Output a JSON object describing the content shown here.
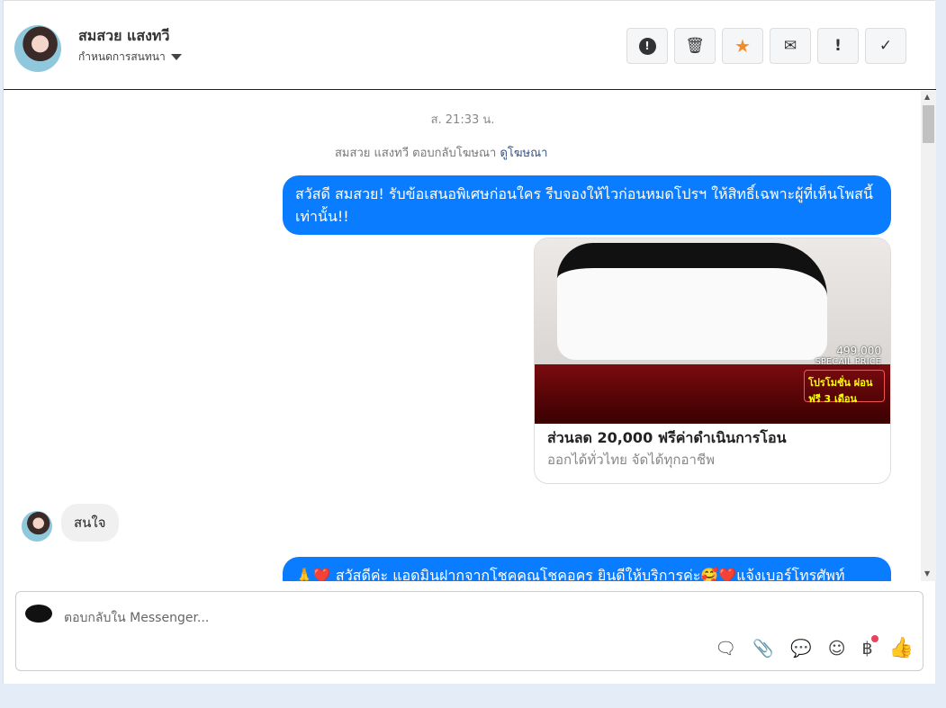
{
  "header": {
    "name": "สมสวย แสงทวี",
    "subtitle": "กำหนดการสนทนา",
    "buttons": [
      {
        "icon": "alert-icon",
        "glyph": "!"
      },
      {
        "icon": "trash-icon",
        "glyph": "🗑"
      },
      {
        "icon": "star-icon",
        "glyph": "★"
      },
      {
        "icon": "envelope-icon",
        "glyph": "✉"
      },
      {
        "icon": "exclamation-icon",
        "glyph": "!"
      },
      {
        "icon": "check-icon",
        "glyph": "✓"
      }
    ]
  },
  "chat": {
    "timestamp": "ส. 21:33 น.",
    "ad_note": "สมสวย แสงทวี ตอบกลับโฆษณา",
    "ad_link": "ดูโฆษณา",
    "msg1": "สวัสดี สมสวย! รับข้อเสนอพิเศษก่อนใคร รีบจองให้ไวก่อนหมดโปรฯ ให้สิทธิ์เฉพาะผู้ที่เห็นโพสนี้เท่านั้น!!",
    "card": {
      "price": "499,000",
      "price_label": "SPECAIL PRICE",
      "promo": "โปรโมชั่น ผ่อนฟรี 3 เดือน",
      "title": "ส่วนลด 20,000 ฟรีค่าดำเนินการโอน",
      "subtitle": "ออกได้ทั่วไทย จัดได้ทุกอาชีพ"
    },
    "incoming": "สนใจ",
    "msg2": "🙏❤️ สวัสดีค่ะ แอดมินฝากจากโชคคูณโชคอคร ยินดีให้บริการค่ะ🥰❤️แจ้งเบอร์โทรศัพท์"
  },
  "composer": {
    "placeholder": "ตอบกลับใน Messenger...",
    "tools": [
      "saved-reply-icon",
      "attachment-icon",
      "comment-icon",
      "emoji-icon",
      "baht-icon",
      "like-icon"
    ]
  },
  "colors": {
    "accent": "#0a7cff",
    "badge": "#e8425f"
  }
}
